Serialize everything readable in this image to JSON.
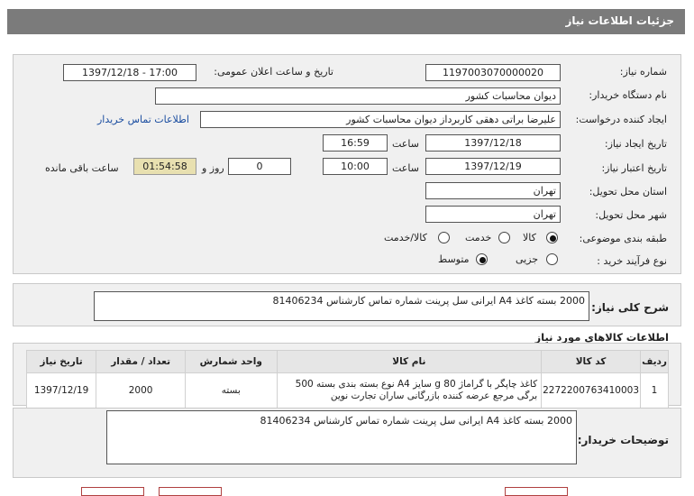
{
  "page": {
    "title": "جزئیات اطلاعات نیاز"
  },
  "form": {
    "need_number": {
      "label": "شماره نیاز:",
      "value": "1197003070000020"
    },
    "announce_datetime": {
      "label": "تاریخ و ساعت اعلان عمومی:",
      "value": "1397/12/18 - 17:00"
    },
    "buyer_org": {
      "label": "نام دستگاه خریدار:",
      "value": "دیوان محاسبات کشور"
    },
    "requester": {
      "label": "ایجاد کننده درخواست:",
      "value": "علیرضا براتی دهقی کاربرداز دیوان محاسبات کشور"
    },
    "contact_link": "اطلاعات تماس خریدار",
    "created": {
      "label": "تاریخ ایجاد نیاز:",
      "date": "1397/12/18",
      "time_label": "ساعت",
      "time": "16:59"
    },
    "validity": {
      "label": "تاریخ اعتبار نیاز:",
      "date": "1397/12/19",
      "time_label": "ساعت",
      "time": "10:00",
      "days": "0",
      "days_label": "روز و",
      "remaining": "01:54:58",
      "remaining_label": "ساعت باقی مانده"
    },
    "province": {
      "label": "استان محل تحویل:",
      "value": "تهران"
    },
    "city": {
      "label": "شهر محل تحویل:",
      "value": "تهران"
    },
    "category": {
      "label": "طبقه بندی موضوعی:",
      "options": [
        "کالا",
        "خدمت",
        "کالا/خدمت"
      ],
      "selected": "کالا"
    },
    "purchase_type": {
      "label": "نوع فرآیند خرید :",
      "options": [
        "جزیی",
        "متوسط"
      ],
      "selected": "متوسط"
    }
  },
  "summary": {
    "label": "شرح کلی نیاز:",
    "value": "2000 بسته کاغذ A4 ایرانی سل پرینت شماره تماس کارشناس 81406234"
  },
  "items": {
    "heading": "اطلاعات کالاهای مورد نیاز",
    "headers": [
      "ردیف",
      "کد کالا",
      "نام کالا",
      "واحد شمارش",
      "تعداد / مقدار",
      "تاریخ نیاز"
    ],
    "rows": [
      {
        "row": "1",
        "code": "2272200763410003",
        "name": "کاغذ چاپگر با گراماژ g 80 سایز A4 نوع بسته بندی بسته 500 برگی مرجع عرضه کننده بازرگانی ساران تجارت نوین",
        "unit": "بسته",
        "qty": "2000",
        "date": "1397/12/19"
      }
    ]
  },
  "buyer_notes": {
    "label": "توضیحات خریدار:",
    "value": "2000 بسته کاغذ A4 ایرانی سل پرینت شماره تماس کارشناس 81406234"
  },
  "colors": {
    "title_bg": "#7b7b7b",
    "panel_bg": "#f0f0f0",
    "link": "#1a4da0",
    "remaining_bg": "#e8e0b0"
  }
}
